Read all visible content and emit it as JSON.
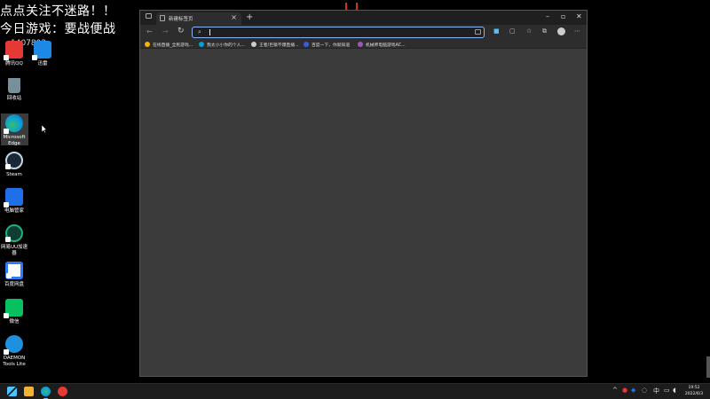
{
  "overlay": {
    "line1": "点点关注不迷路！！",
    "line2": "今日游戏：要战便战",
    "line3": "1407802"
  },
  "desktop": {
    "icons": [
      {
        "label": "腾讯QQ",
        "icon": "qq-icon",
        "color": "#e53935"
      },
      {
        "label": "迅雷",
        "icon": "xunlei-icon",
        "color": "#1e88e5"
      },
      {
        "label": "回收站",
        "icon": "recycle-bin-icon",
        "color": "#90a4ae"
      },
      {
        "label": "Microsoft Edge",
        "icon": "edge-icon",
        "color": "#0c9ed9"
      },
      {
        "label": "Steam",
        "icon": "steam-icon",
        "color": "#1b2838"
      },
      {
        "label": "电脑管家",
        "icon": "pc-manager-icon",
        "color": "#1e6fe8"
      },
      {
        "label": "网易UU加速器",
        "icon": "uu-accelerator-icon",
        "color": "#19b27b"
      },
      {
        "label": "百度网盘",
        "icon": "baidu-netdisk-icon",
        "color": "#2f7bf6"
      },
      {
        "label": "微信",
        "icon": "wechat-icon",
        "color": "#07c160"
      },
      {
        "label": "DAEMON Tools Lite",
        "icon": "daemon-tools-icon",
        "color": "#1f8fe0"
      }
    ]
  },
  "browser": {
    "tab_title": "新建标签页",
    "address_value": "",
    "address_placeholder": "",
    "favorites": [
      {
        "label": "在线直播_全民游戏...",
        "color": "#f4b400"
      },
      {
        "label": "我太小小你的个人...",
        "color": "#00a1d6"
      },
      {
        "label": "王者/巨猿不爆直播...",
        "color": "#cccccc"
      },
      {
        "label": "百度一下，你就知道",
        "color": "#3b5bdb"
      },
      {
        "label": "机械师电脑游戏AC...",
        "color": "#9b59b6"
      }
    ],
    "theme": {
      "frame": "#1f1f1f",
      "toolbar": "#2d2d2d",
      "content": "#3b3b3b",
      "accent": "#8ab4f8"
    }
  },
  "taskbar": {
    "apps": [
      {
        "name": "windows-start-icon",
        "color": "#4cc2ff"
      },
      {
        "name": "file-explorer-icon",
        "color": "#f2b233"
      },
      {
        "name": "edge-taskbar-icon",
        "color": "#0c9ed9"
      },
      {
        "name": "app-red-taskbar-icon",
        "color": "#e53935"
      }
    ],
    "input_method": "中",
    "time": "19:52",
    "date": "2022/6/3"
  }
}
